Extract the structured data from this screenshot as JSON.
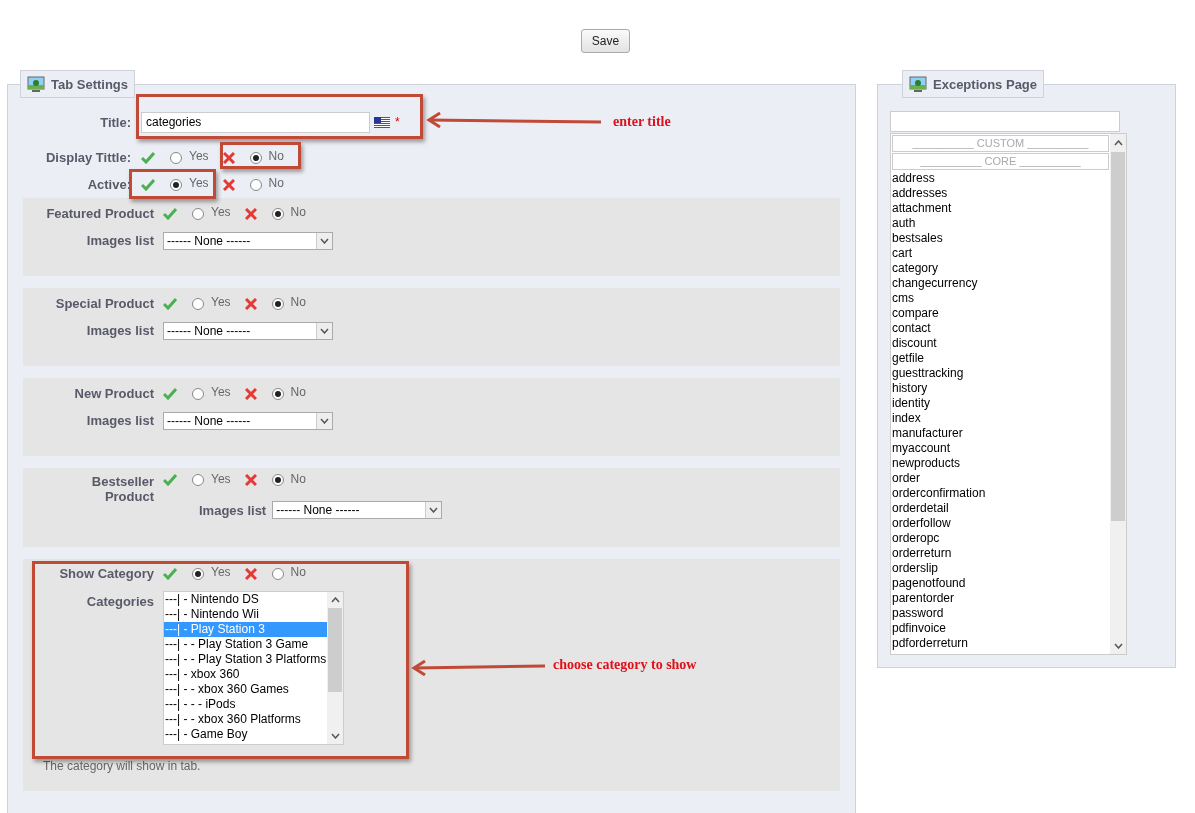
{
  "save_button": "Save",
  "tab_settings": {
    "legend": "Tab Settings",
    "title_field": {
      "label": "Title:",
      "value": "categories",
      "required": "*"
    },
    "toggles": [
      {
        "label": "Display Tittle:",
        "options": [
          {
            "label": "Yes",
            "selected": false
          },
          {
            "label": "No",
            "selected": true
          }
        ]
      },
      {
        "label": "Active:",
        "options": [
          {
            "label": "Yes",
            "selected": true
          },
          {
            "label": "No",
            "selected": false
          }
        ]
      }
    ],
    "panels": [
      {
        "kind": "standard",
        "label": "Featured Product",
        "options": [
          {
            "label": "Yes",
            "selected": false
          },
          {
            "label": "No",
            "selected": true
          }
        ],
        "images_label": "Images list",
        "images_value": "------ None ------"
      },
      {
        "kind": "standard",
        "label": "Special Product",
        "options": [
          {
            "label": "Yes",
            "selected": false
          },
          {
            "label": "No",
            "selected": true
          }
        ],
        "images_label": "Images list",
        "images_value": "------ None ------"
      },
      {
        "kind": "standard",
        "label": "New Product",
        "options": [
          {
            "label": "Yes",
            "selected": false
          },
          {
            "label": "No",
            "selected": true
          }
        ],
        "images_label": "Images list",
        "images_value": "------ None ------"
      },
      {
        "kind": "stacked",
        "label": "Bestseller Product",
        "options": [
          {
            "label": "Yes",
            "selected": false
          },
          {
            "label": "No",
            "selected": true
          }
        ],
        "images_label": "Images list",
        "images_value": "------ None ------"
      },
      {
        "kind": "category",
        "label": "Show Category",
        "options": [
          {
            "label": "Yes",
            "selected": true
          },
          {
            "label": "No",
            "selected": false
          }
        ],
        "list_label": "Categories",
        "help": "The category will show in tab.",
        "items": [
          {
            "label": "---| - Nintendo DS",
            "selected": false
          },
          {
            "label": "---| - Nintendo Wii",
            "selected": false
          },
          {
            "label": "---| - Play Station 3",
            "selected": true
          },
          {
            "label": "---| - - Play Station 3 Game",
            "selected": false
          },
          {
            "label": "---| - - Play Station 3 Platforms",
            "selected": false
          },
          {
            "label": "---| - xbox 360",
            "selected": false
          },
          {
            "label": "---| - - xbox 360 Games",
            "selected": false
          },
          {
            "label": "---| - - - iPods",
            "selected": false
          },
          {
            "label": "---| - - xbox 360 Platforms",
            "selected": false
          },
          {
            "label": "---| - Game Boy",
            "selected": false
          }
        ]
      }
    ]
  },
  "exceptions": {
    "legend": "Exceptions Page",
    "items": [
      {
        "kind": "separator",
        "label": "__________ CUSTOM __________"
      },
      {
        "kind": "separator",
        "label": "__________ CORE __________"
      },
      {
        "kind": "page",
        "label": "address"
      },
      {
        "kind": "page",
        "label": "addresses"
      },
      {
        "kind": "page",
        "label": "attachment"
      },
      {
        "kind": "page",
        "label": "auth"
      },
      {
        "kind": "page",
        "label": "bestsales"
      },
      {
        "kind": "page",
        "label": "cart"
      },
      {
        "kind": "page",
        "label": "category"
      },
      {
        "kind": "page",
        "label": "changecurrency"
      },
      {
        "kind": "page",
        "label": "cms"
      },
      {
        "kind": "page",
        "label": "compare"
      },
      {
        "kind": "page",
        "label": "contact"
      },
      {
        "kind": "page",
        "label": "discount"
      },
      {
        "kind": "page",
        "label": "getfile"
      },
      {
        "kind": "page",
        "label": "guesttracking"
      },
      {
        "kind": "page",
        "label": "history"
      },
      {
        "kind": "page",
        "label": "identity"
      },
      {
        "kind": "page",
        "label": "index"
      },
      {
        "kind": "page",
        "label": "manufacturer"
      },
      {
        "kind": "page",
        "label": "myaccount"
      },
      {
        "kind": "page",
        "label": "newproducts"
      },
      {
        "kind": "page",
        "label": "order"
      },
      {
        "kind": "page",
        "label": "orderconfirmation"
      },
      {
        "kind": "page",
        "label": "orderdetail"
      },
      {
        "kind": "page",
        "label": "orderfollow"
      },
      {
        "kind": "page",
        "label": "orderopc"
      },
      {
        "kind": "page",
        "label": "orderreturn"
      },
      {
        "kind": "page",
        "label": "orderslip"
      },
      {
        "kind": "page",
        "label": "pagenotfound"
      },
      {
        "kind": "page",
        "label": "parentorder"
      },
      {
        "kind": "page",
        "label": "password"
      },
      {
        "kind": "page",
        "label": "pdfinvoice"
      },
      {
        "kind": "page",
        "label": "pdforderreturn"
      }
    ]
  },
  "annotations": [
    {
      "text": "enter title"
    },
    {
      "text": "choose category to show"
    }
  ]
}
